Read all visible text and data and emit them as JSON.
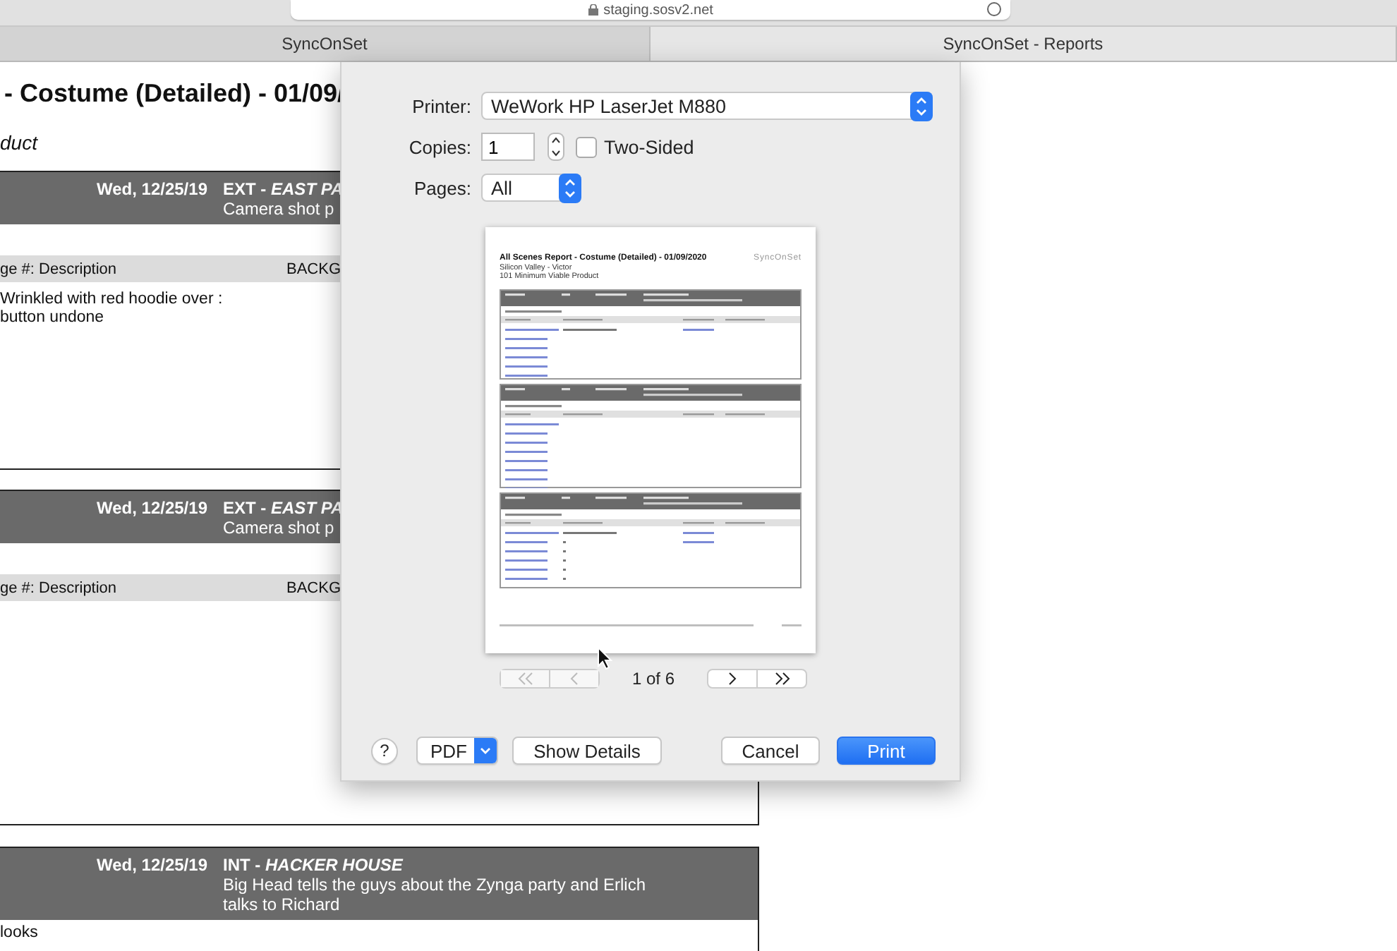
{
  "browser": {
    "address": "staging.sosv2.net"
  },
  "tabs": [
    {
      "label": "SyncOnSet",
      "selected": false
    },
    {
      "label": "SyncOnSet - Reports",
      "selected": true
    }
  ],
  "report": {
    "title": "- Costume (Detailed) - 01/09/",
    "subtitle": "duct",
    "scenes": [
      {
        "date": "Wed, 12/25/19",
        "setting": "EXT - ",
        "location": "EAST PA",
        "description": [
          "Camera shot p"
        ],
        "columns": [
          "ge #: Description",
          "BACKG"
        ],
        "lines": [
          "Wrinkled with red hoodie over :",
          "button undone"
        ]
      },
      {
        "date": "Wed, 12/25/19",
        "setting": "EXT - ",
        "location": "EAST PA",
        "description": [
          "Camera shot p"
        ],
        "columns": [
          "ge #: Description",
          "BACKG"
        ]
      },
      {
        "date": "Wed, 12/25/19",
        "setting": "INT - ",
        "location": "HACKER HOUSE",
        "description": [
          "Big Head tells the guys about the Zynga party and Erlich",
          "talks to Richard"
        ],
        "lines": [
          "looks"
        ]
      }
    ]
  },
  "print_dialog": {
    "printer": {
      "label": "Printer:",
      "value": "WeWork HP LaserJet M880"
    },
    "copies": {
      "label": "Copies:",
      "value": "1"
    },
    "two_sided": {
      "label": "Two-Sided",
      "checked": false
    },
    "pages": {
      "label": "Pages:",
      "value": "All"
    },
    "preview": {
      "title": "All Scenes Report - Costume (Detailed) - 01/09/2020",
      "lines": [
        "Silicon Valley - Victor",
        "101 Minimum Viable Product"
      ],
      "logo": "SyncOnSet"
    },
    "pager": [
      {
        "kind": "first",
        "disabled": true
      },
      {
        "kind": "previous",
        "disabled": true
      },
      {
        "kind": "next",
        "disabled": false
      },
      {
        "kind": "last",
        "disabled": false
      }
    ],
    "page_indicator": "1 of 6",
    "buttons": [
      {
        "kind": "help",
        "label": "?"
      },
      {
        "kind": "menu",
        "label": "PDF"
      },
      {
        "kind": "plain",
        "label": "Show Details"
      },
      {
        "kind": "plain",
        "label": "Cancel"
      },
      {
        "kind": "primary",
        "label": "Print"
      }
    ]
  }
}
